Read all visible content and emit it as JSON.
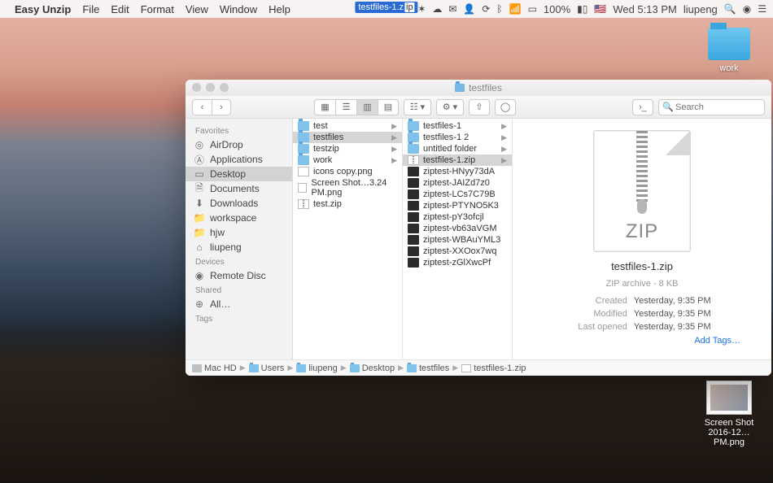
{
  "menubar": {
    "app": "Easy Unzip",
    "items": [
      "File",
      "Edit",
      "Format",
      "View",
      "Window",
      "Help"
    ],
    "center_file": "testfiles-1.z",
    "center_ext": "ip",
    "clock": "Wed 5:13 PM",
    "user": "liupeng",
    "battery": "100%",
    "flag": "🇺🇸"
  },
  "desktop": {
    "work_folder": "work",
    "screenshot": "Screen Shot 2016-12…PM.png"
  },
  "finder": {
    "title": "testfiles",
    "search_placeholder": "Search",
    "sidebar": {
      "favorites_hdr": "Favorites",
      "favorites": [
        {
          "icon": "◎",
          "label": "AirDrop"
        },
        {
          "icon": "Ⓐ",
          "label": "Applications"
        },
        {
          "icon": "▭",
          "label": "Desktop",
          "sel": true
        },
        {
          "icon": "🗎",
          "label": "Documents"
        },
        {
          "icon": "⬇",
          "label": "Downloads"
        },
        {
          "icon": "📁",
          "label": "workspace"
        },
        {
          "icon": "📁",
          "label": "hjw"
        },
        {
          "icon": "⌂",
          "label": "liupeng"
        }
      ],
      "devices_hdr": "Devices",
      "devices": [
        {
          "icon": "◉",
          "label": "Remote Disc"
        }
      ],
      "shared_hdr": "Shared",
      "shared": [
        {
          "icon": "⊕",
          "label": "All…"
        }
      ],
      "tags_hdr": "Tags"
    },
    "col1": [
      {
        "t": "folder",
        "n": "test",
        "chev": true
      },
      {
        "t": "folder",
        "n": "testfiles",
        "chev": true,
        "sel": true
      },
      {
        "t": "folder",
        "n": "testzip",
        "chev": true
      },
      {
        "t": "folder",
        "n": "work",
        "chev": true
      },
      {
        "t": "png",
        "n": "icons copy.png"
      },
      {
        "t": "png",
        "n": "Screen Shot…3.24 PM.png"
      },
      {
        "t": "zip",
        "n": "test.zip"
      }
    ],
    "col2": [
      {
        "t": "folder",
        "n": "testfiles-1",
        "chev": true
      },
      {
        "t": "folder",
        "n": "testfiles-1 2",
        "chev": true
      },
      {
        "t": "folder",
        "n": "untitled folder",
        "chev": true
      },
      {
        "t": "zip",
        "n": "testfiles-1.zip",
        "chev": true,
        "sel": true
      },
      {
        "t": "term",
        "n": "ziptest-HNyy73dA"
      },
      {
        "t": "term",
        "n": "ziptest-JAIZd7z0"
      },
      {
        "t": "term",
        "n": "ziptest-LCs7C79B"
      },
      {
        "t": "term",
        "n": "ziptest-PTYNO5K3"
      },
      {
        "t": "term",
        "n": "ziptest-pY3ofcjl"
      },
      {
        "t": "term",
        "n": "ziptest-vb63aVGM"
      },
      {
        "t": "term",
        "n": "ziptest-WBAuYML3"
      },
      {
        "t": "term",
        "n": "ziptest-XXOox7wq"
      },
      {
        "t": "term",
        "n": "ziptest-zGlXwcPf"
      }
    ],
    "preview": {
      "zip_label": "ZIP",
      "filename": "testfiles-1.zip",
      "kind": "ZIP archive - 8 KB",
      "rows": [
        {
          "k": "Created",
          "v": "Yesterday, 9:35 PM"
        },
        {
          "k": "Modified",
          "v": "Yesterday, 9:35 PM"
        },
        {
          "k": "Last opened",
          "v": "Yesterday, 9:35 PM"
        }
      ],
      "add_tags": "Add Tags…"
    },
    "path": [
      "Mac HD",
      "Users",
      "liupeng",
      "Desktop",
      "testfiles",
      "testfiles-1.zip"
    ],
    "path_icons": [
      "hd",
      "fold",
      "fold",
      "fold",
      "fold",
      "zipf"
    ]
  }
}
